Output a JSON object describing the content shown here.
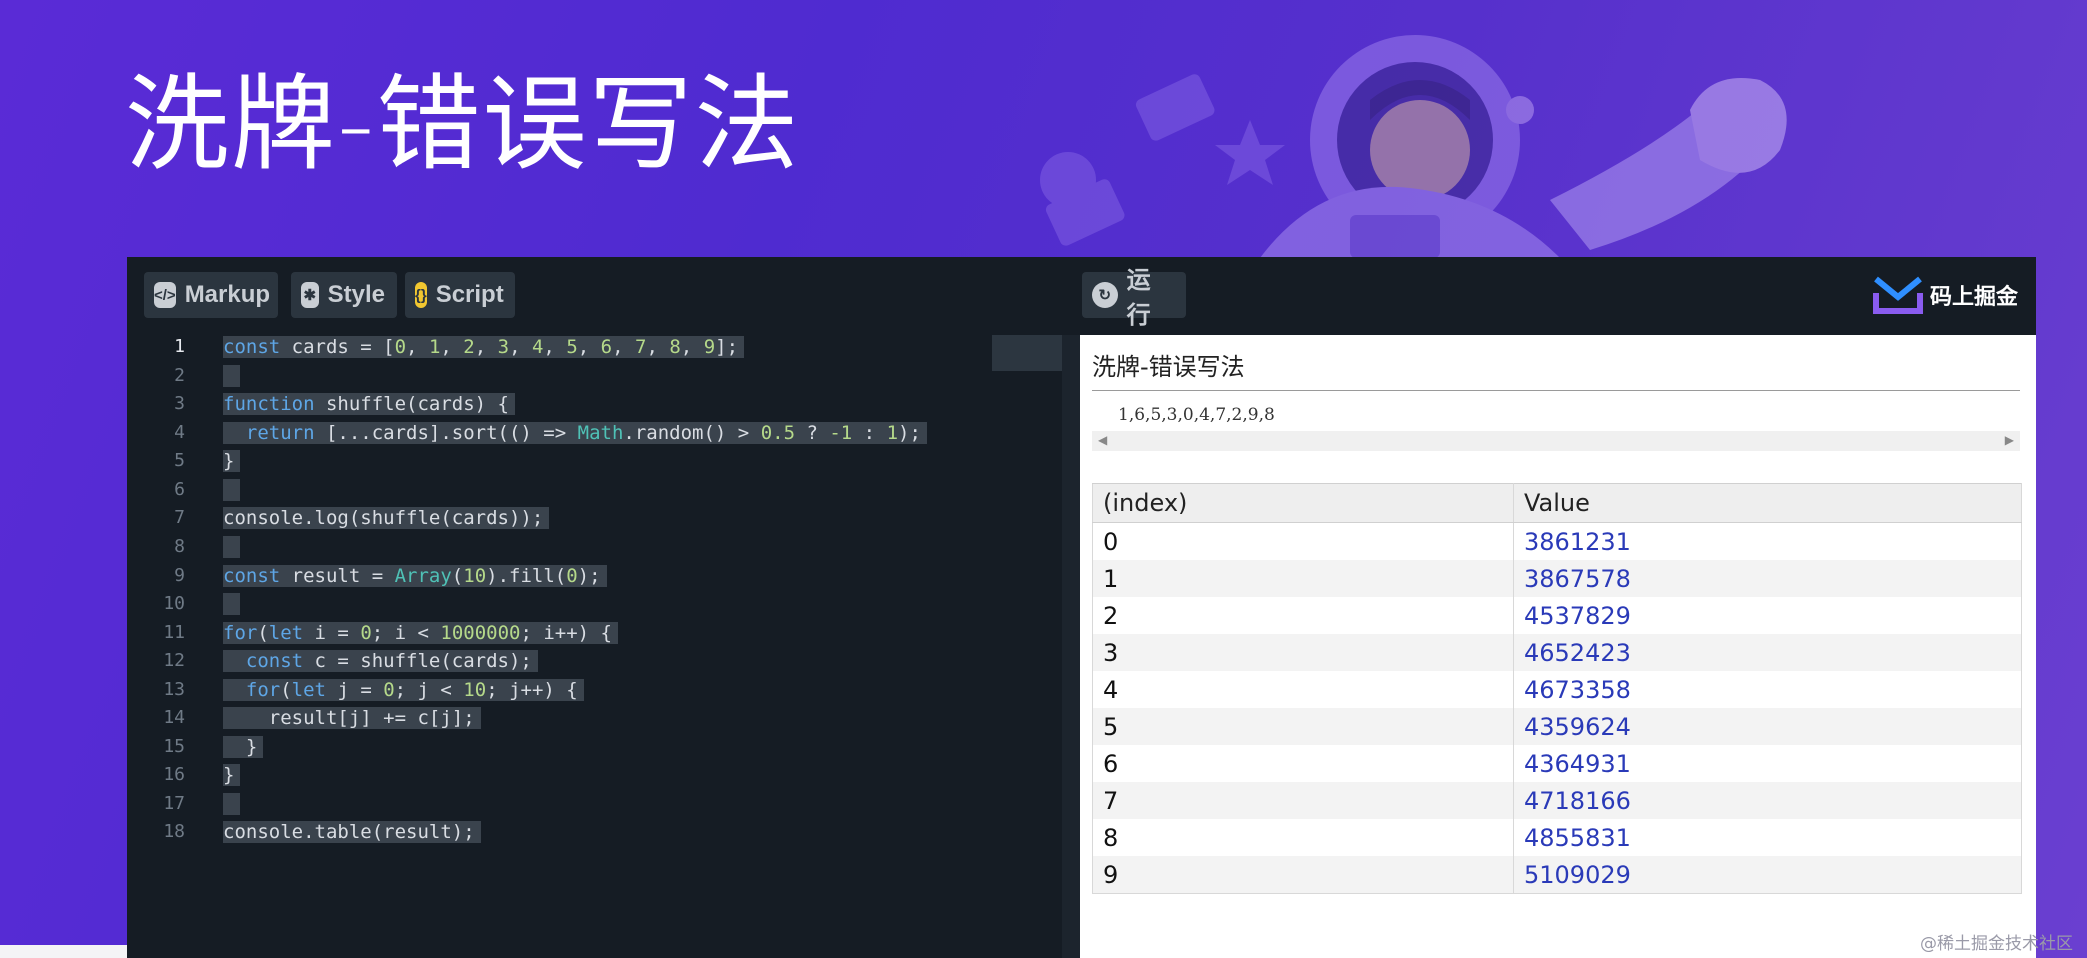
{
  "slide": {
    "title": "洗牌-错误写法"
  },
  "toolbar": {
    "tabs": [
      {
        "label": "Markup",
        "icon": "code-icon"
      },
      {
        "label": "Style",
        "icon": "asterisk-icon"
      },
      {
        "label": "Script",
        "icon": "braces-icon"
      }
    ],
    "run_label": "运行",
    "brand": "码上掘金"
  },
  "editor": {
    "line_numbers": [
      "1",
      "2",
      "3",
      "4",
      "5",
      "6",
      "7",
      "8",
      "9",
      "10",
      "11",
      "12",
      "13",
      "14",
      "15",
      "16",
      "17",
      "18"
    ],
    "lines": [
      "const cards = [0, 1, 2, 3, 4, 5, 6, 7, 8, 9];",
      "",
      "function shuffle(cards) {",
      "  return [...cards].sort(() => Math.random() > 0.5 ? -1 : 1);",
      "}",
      "",
      "console.log(shuffle(cards));",
      "",
      "const result = Array(10).fill(0);",
      "",
      "for(let i = 0; i < 1000000; i++) {",
      "  const c = shuffle(cards);",
      "  for(let j = 0; j < 10; j++) {",
      "    result[j] += c[j];",
      "  }",
      "}",
      "",
      "console.table(result);"
    ]
  },
  "preview": {
    "title": "洗牌-错误写法",
    "log_output": "1,6,5,3,0,4,7,2,9,8",
    "table": {
      "headers": [
        "(index)",
        "Value"
      ],
      "rows": [
        [
          "0",
          "3861231"
        ],
        [
          "1",
          "3867578"
        ],
        [
          "2",
          "4537829"
        ],
        [
          "3",
          "4652423"
        ],
        [
          "4",
          "4673358"
        ],
        [
          "5",
          "4359624"
        ],
        [
          "6",
          "4364931"
        ],
        [
          "7",
          "4718166"
        ],
        [
          "8",
          "4855831"
        ],
        [
          "9",
          "5109029"
        ]
      ]
    }
  },
  "watermark": "@稀土掘金技术社区"
}
